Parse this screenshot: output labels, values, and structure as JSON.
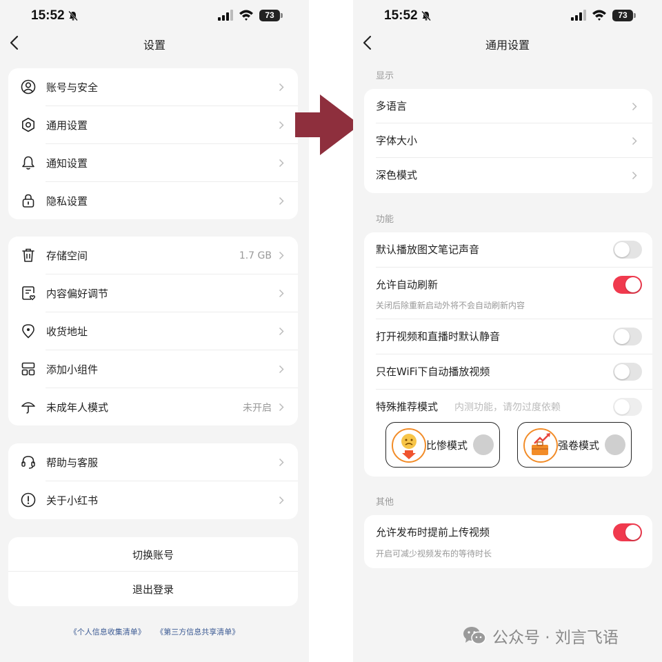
{
  "left": {
    "status_time": "15:52",
    "battery": "73",
    "nav_title": "设置",
    "group1": [
      {
        "label": "账号与安全",
        "icon": "user-circle-icon"
      },
      {
        "label": "通用设置",
        "icon": "gear-icon"
      },
      {
        "label": "通知设置",
        "icon": "bell-icon"
      },
      {
        "label": "隐私设置",
        "icon": "lock-icon"
      }
    ],
    "group2": [
      {
        "label": "存储空间",
        "value": "1.7 GB",
        "icon": "trash-icon"
      },
      {
        "label": "内容偏好调节",
        "icon": "content-preference-icon"
      },
      {
        "label": "收货地址",
        "icon": "location-pin-icon"
      },
      {
        "label": "添加小组件",
        "icon": "widget-grid-icon"
      },
      {
        "label": "未成年人模式",
        "value": "未开启",
        "icon": "umbrella-icon"
      }
    ],
    "group3": [
      {
        "label": "帮助与客服",
        "icon": "headset-icon"
      },
      {
        "label": "关于小红书",
        "icon": "info-circle-icon"
      }
    ],
    "switch_account": "切换账号",
    "logout": "退出登录",
    "footer_link_1": "《个人信息收集清单》",
    "footer_link_2": "《第三方信息共享清单》"
  },
  "right": {
    "status_time": "15:52",
    "battery": "73",
    "nav_title": "通用设置",
    "section_display": "显示",
    "display_items": [
      {
        "label": "多语言"
      },
      {
        "label": "字体大小"
      },
      {
        "label": "深色模式"
      }
    ],
    "section_function": "功能",
    "function_items": [
      {
        "label": "默认播放图文笔记声音",
        "toggle": false
      },
      {
        "label": "允许自动刷新",
        "toggle": true,
        "sub": "关闭后除重新启动外将不会自动刷新内容"
      },
      {
        "label": "打开视频和直播时默认静音",
        "toggle": false
      },
      {
        "label": "只在WiFi下自动播放视频",
        "toggle": false
      },
      {
        "label": "特殊推荐模式",
        "hint": "内测功能，请勿过度依赖",
        "toggle": false
      }
    ],
    "mode_1": "比惨模式",
    "mode_2": "强卷模式",
    "section_other": "其他",
    "other_items": [
      {
        "label": "允许发布时提前上传视频",
        "toggle": true,
        "sub": "开启可减少视频发布的等待时长"
      }
    ]
  },
  "watermark": "公众号 · 刘言飞语",
  "colors": {
    "toggle_on": "#f03a4e",
    "arrow": "#8e2f3d",
    "link": "#3b5a93",
    "page_bg": "#f4f4f4"
  }
}
